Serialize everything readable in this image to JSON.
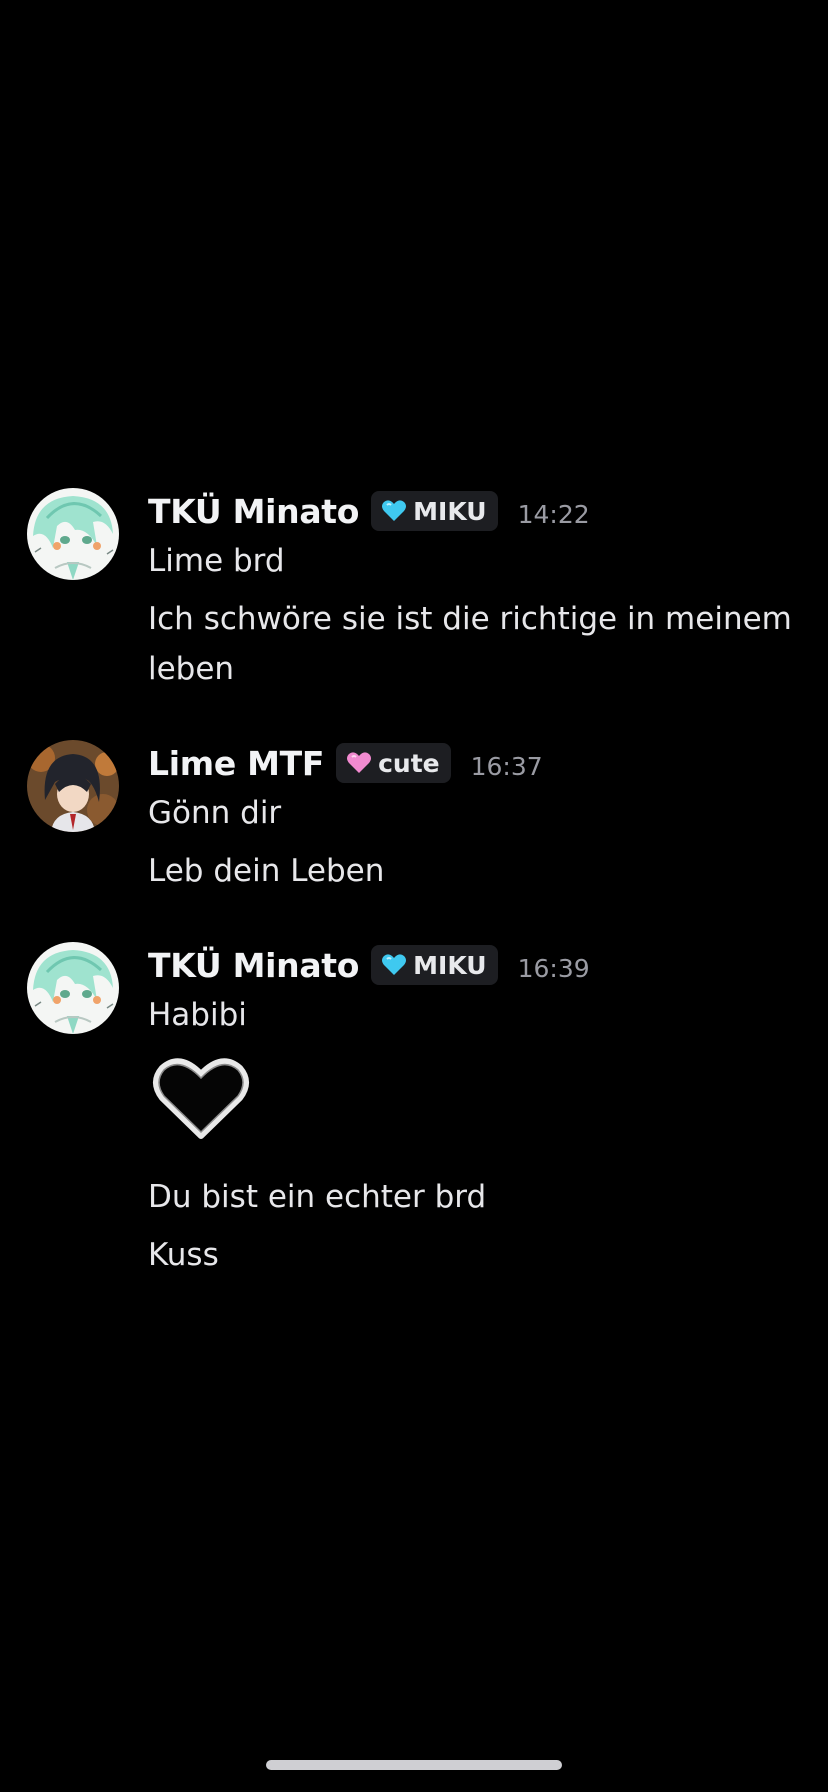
{
  "messages": [
    {
      "username": "TKÜ Minato",
      "tag": {
        "label": "MIKU",
        "icon": "blue-heart-icon",
        "color": "#3fc9f0"
      },
      "time": "14:22",
      "lines": [
        "Lime brd",
        "Ich schwöre sie ist die richtige in meinem leben"
      ]
    },
    {
      "username": "Lime MTF",
      "tag": {
        "label": "cute",
        "icon": "pink-heart-icon",
        "color": "#f28ad0"
      },
      "time": "16:37",
      "lines": [
        "Gönn dir",
        "Leb dein Leben"
      ]
    },
    {
      "username": "TKÜ Minato",
      "tag": {
        "label": "MIKU",
        "icon": "blue-heart-icon",
        "color": "#3fc9f0"
      },
      "time": "16:39",
      "lines": [
        "Habibi",
        "Du bist ein echter brd",
        "Kuss"
      ],
      "emoji": "black-heart-icon"
    }
  ]
}
